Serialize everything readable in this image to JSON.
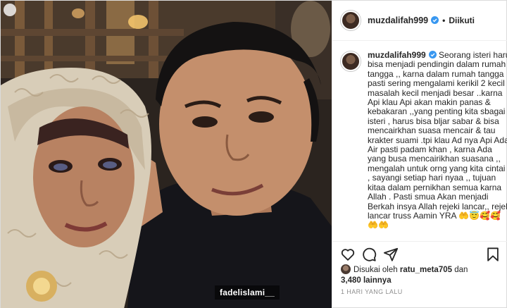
{
  "post": {
    "photo_watermark": "fadelislami__",
    "header": {
      "username": "muzdalifah999",
      "separator": "•",
      "follow_status": "Diikuti"
    },
    "caption": {
      "username": "muzdalifah999",
      "lines": [
        "Seorang isteri harus",
        "bisa menjadi pendingin dalam rumah",
        "tangga ,, karna dalam rumah tangga",
        "pasti sering mengalami kerikil 2 kecil",
        "masalah kecil menjadi besar ..karna",
        "Api klau Api akan makin panas &",
        "kebakaran ,,yang penting kita sbagai",
        "isteri , harus bisa bljar sabar & bisa",
        "mencairkhan suasa mencair & tau",
        "krakter suami .tpi klau Ad nya Api Ada",
        "Air pasti padam khan , karna Ada",
        "yang busa mencairikhan suasana ,,",
        "mengalah untuk orng yang kita cintai",
        ", sayangi setiap hari nyaa ,, tujuan",
        "kitaa dalam pernikhan semua karna",
        "Allah . Pasti smua Akan menjadi",
        "Berkah insya Allah rejeki lancar,, rejeki",
        "lancar truss Aamin YRA 🤲😇🥰🥰",
        "🤲🤲"
      ]
    },
    "likes": {
      "prefix": "Disukai oleh",
      "user": "ratu_meta705",
      "joiner": "dan",
      "others": "3,480 lainnya"
    },
    "timestamp": "1 HARI YANG LALU",
    "icons": [
      "heart-icon",
      "comment-icon",
      "share-icon",
      "bookmark-icon",
      "verified-icon"
    ],
    "colors": {
      "verified": "#3897f0",
      "text": "#262626",
      "muted": "#8e8e8e",
      "border": "#dbdbdb"
    }
  }
}
